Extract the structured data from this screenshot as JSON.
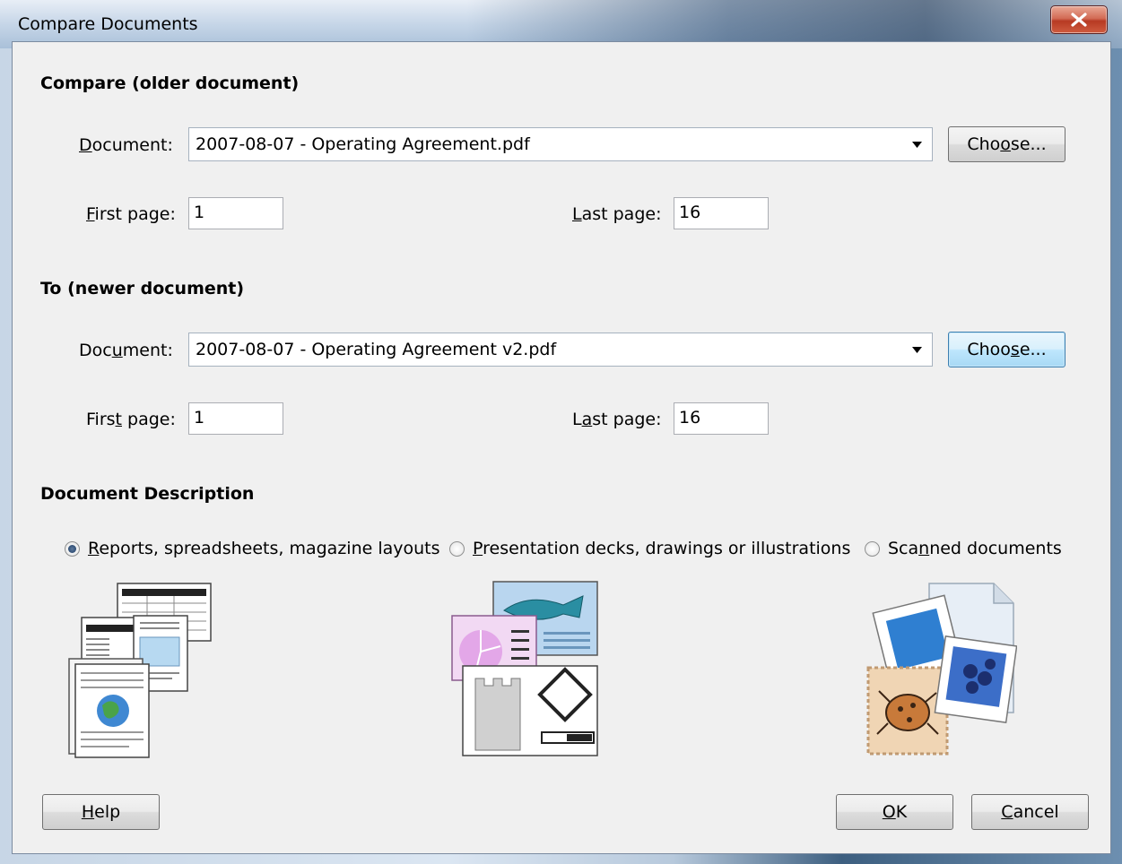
{
  "window": {
    "title": "Compare Documents"
  },
  "older": {
    "heading": "Compare (older document)",
    "document_label": "Document:",
    "document_value": "2007-08-07 - Operating Agreement.pdf",
    "choose_label": "Choose...",
    "first_page_label": "First page:",
    "first_page_value": "1",
    "last_page_label": "Last page:",
    "last_page_value": "16"
  },
  "newer": {
    "heading": "To (newer document)",
    "document_label": "Document:",
    "document_value": "2007-08-07 - Operating Agreement v2.pdf",
    "choose_label": "Choose...",
    "first_page_label": "First page:",
    "first_page_value": "1",
    "last_page_label": "Last page:",
    "last_page_value": "16"
  },
  "description": {
    "heading": "Document Description",
    "options": [
      {
        "label": "Reports, spreadsheets, magazine layouts",
        "selected": true,
        "icon": "reports-icon"
      },
      {
        "label": "Presentation decks, drawings or illustrations",
        "selected": false,
        "icon": "presentation-icon"
      },
      {
        "label": "Scanned documents",
        "selected": false,
        "icon": "scanned-icon"
      }
    ]
  },
  "buttons": {
    "help": "Help",
    "ok": "OK",
    "cancel": "Cancel"
  },
  "colors": {
    "focus_border": "#3c7fb1",
    "close_red": "#c44a32"
  }
}
